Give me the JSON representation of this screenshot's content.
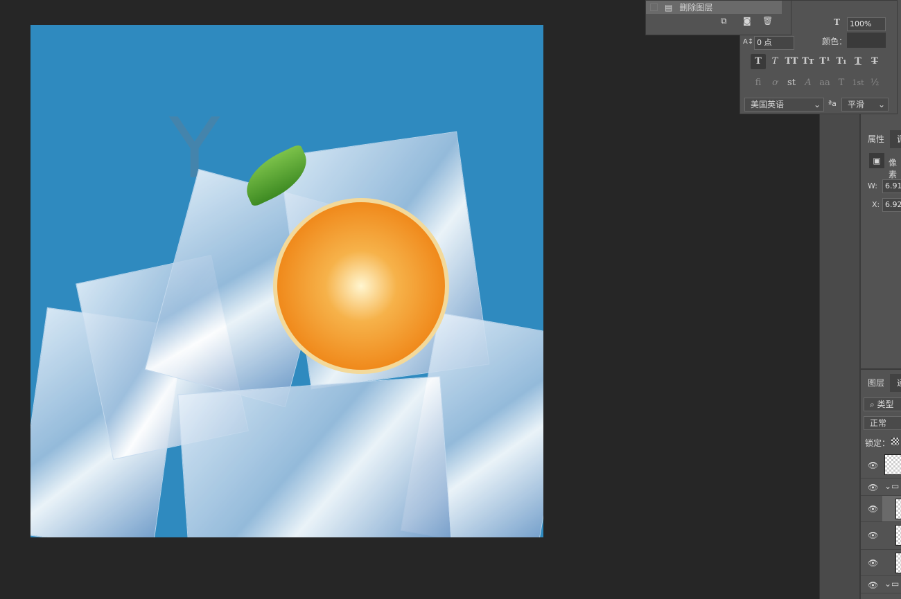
{
  "history": {
    "item_label": "删除图层"
  },
  "character": {
    "scale_value": "100%",
    "tracking_value": "0 点",
    "color_label": "颜色：",
    "style_buttons": [
      "T",
      "T",
      "TT",
      "Tт",
      "T¹",
      "T₁",
      "T",
      "T"
    ],
    "opentype_buttons": [
      "fi",
      "ơ",
      "st",
      "A",
      "aa",
      "T",
      "1st",
      "½"
    ],
    "language": "美国英语",
    "aa_label": "ªa",
    "antialias": "平滑"
  },
  "properties": {
    "tab": "属性",
    "tab2": "调",
    "kind": "像素",
    "w_label": "W:",
    "w_value": "6.91",
    "x_label": "X:",
    "x_value": "6.92"
  },
  "layers": {
    "tab": "图层",
    "tab2": "通",
    "filter": "类型",
    "blend": "正常",
    "lock_label": "锁定："
  }
}
